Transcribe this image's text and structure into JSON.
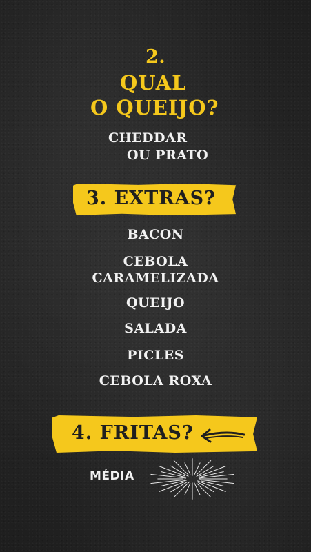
{
  "q2": {
    "number": "2.",
    "title_line1": "QUAL",
    "title_line2": "O QUEIJO?",
    "answer_line1": "CHEDDAR",
    "answer_line2": "OU PRATO"
  },
  "q3": {
    "title": "3. EXTRAS?",
    "items": [
      "BACON",
      "CEBOLA",
      "CARAMELIZADA",
      "QUEIJO",
      "SALADA",
      "PICLES",
      "CEBOLA ROXA"
    ]
  },
  "q4": {
    "title": "4. FRITAS?",
    "answer": "MÉDIA"
  },
  "icons": [
    "arrow-left-icon",
    "sunburst-icon"
  ],
  "colors": {
    "accent": "#f5c81c",
    "background": "#262626",
    "text": "#f2f2f2"
  }
}
